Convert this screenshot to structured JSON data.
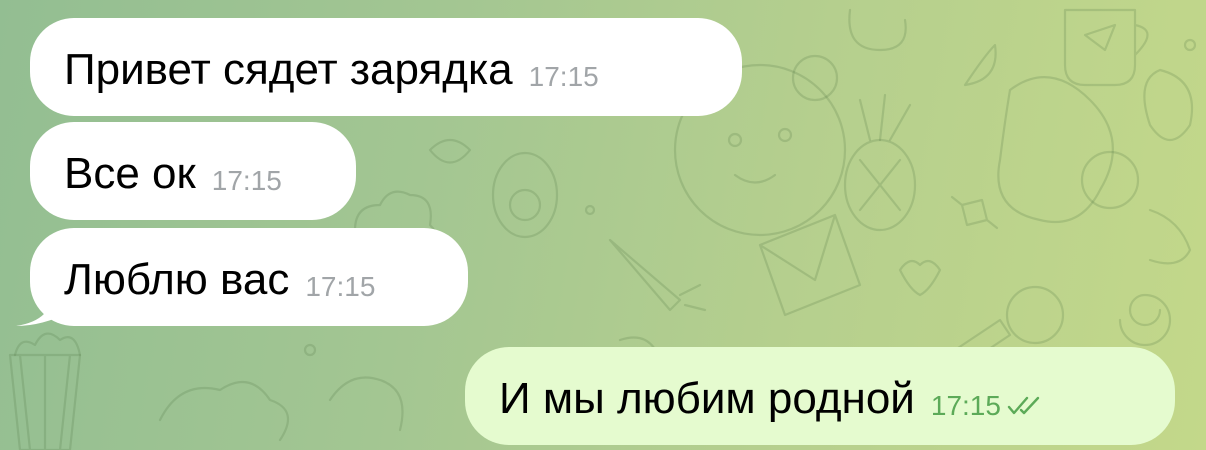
{
  "chat": {
    "messages": [
      {
        "direction": "incoming",
        "text": "Привет сядет зарядка",
        "time": "17:15"
      },
      {
        "direction": "incoming",
        "text": "Все ок",
        "time": "17:15"
      },
      {
        "direction": "incoming",
        "text": "Люблю вас",
        "time": "17:15"
      },
      {
        "direction": "outgoing",
        "text": "И мы любим родной",
        "time": "17:15",
        "status": "read-double-check-icon"
      }
    ]
  },
  "colors": {
    "incoming_bubble": "#ffffff",
    "outgoing_bubble": "#e5fbcf",
    "incoming_time": "#a1a5a8",
    "outgoing_time": "#5caa58",
    "background_left": "#93be92",
    "background_right": "#c3d88a"
  }
}
